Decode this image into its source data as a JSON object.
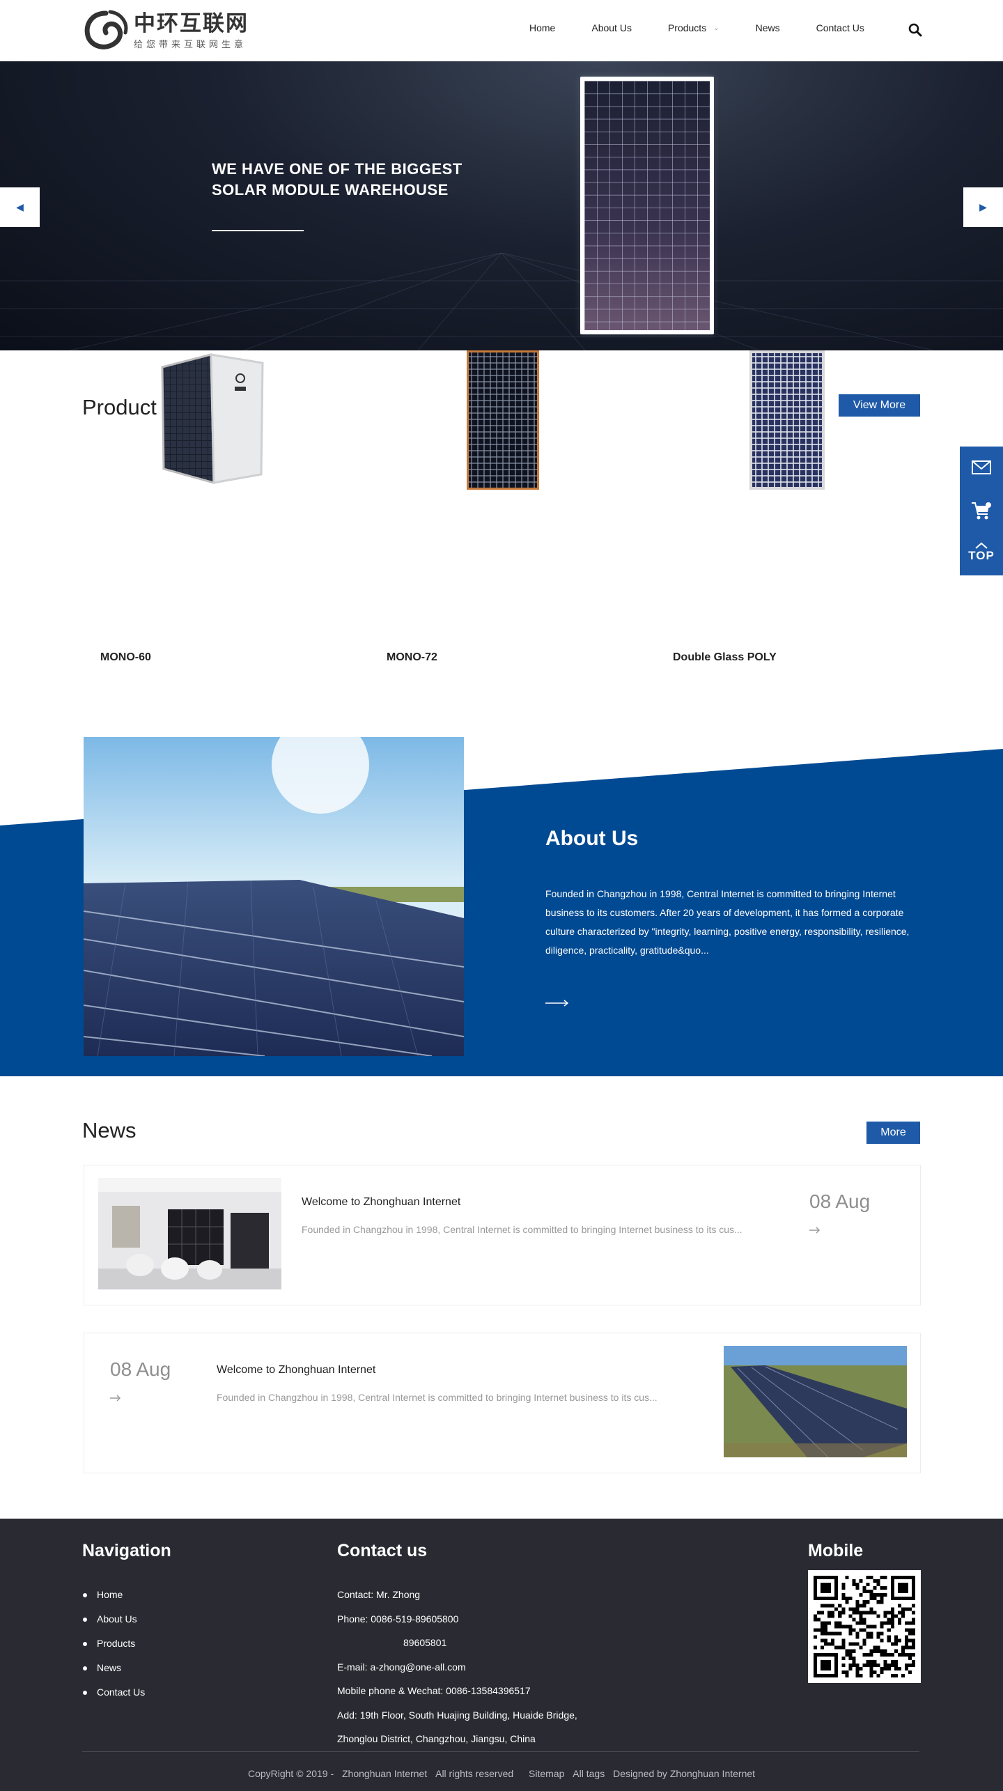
{
  "header": {
    "logo_cn": "中环互联网",
    "logo_sub": "给您带来互联网生意",
    "nav": [
      "Home",
      "About Us",
      "Products",
      "News",
      "Contact Us"
    ]
  },
  "banner": {
    "title_line1": "WE HAVE ONE OF THE BIGGEST",
    "title_line2": "SOLAR MODULE WAREHOUSE"
  },
  "products": {
    "title": "Product Center",
    "view_more": "View More",
    "items": [
      "MONO-60",
      "MONO-72",
      "Double Glass POLY"
    ]
  },
  "about": {
    "title": "About Us",
    "text": "Founded in Changzhou in 1998, Central Internet is committed to bringing Internet business to its customers. After 20 years of development, it has formed a corporate culture characterized by \"integrity, learning, positive energy, responsibility, resilience, diligence, practicality, gratitude&quo..."
  },
  "news": {
    "title": "News",
    "more": "More",
    "items": [
      {
        "title": "Welcome to Zhonghuan Internet",
        "desc": "Founded in Changzhou in 1998, Central Internet is committed to bringing Internet business to its cus...",
        "date": "08 Aug"
      },
      {
        "title": "Welcome to Zhonghuan Internet",
        "desc": "Founded in Changzhou in 1998, Central Internet is committed to bringing Internet business to its cus...",
        "date": "08 Aug"
      }
    ]
  },
  "sidebar": {
    "top": "TOP"
  },
  "footer": {
    "nav_title": "Navigation",
    "nav": [
      "Home",
      "About Us",
      "Products",
      "News",
      "Contact Us"
    ],
    "contact_title": "Contact us",
    "contact": {
      "person": "Contact: Mr. Zhong",
      "phone": "Phone: 0086-519-89605800",
      "phone2": "89605801",
      "email": "E-mail: a-zhong@one-all.com",
      "mobile": "Mobile phone & Wechat: 0086-13584396517",
      "address1": "Add: 19th Floor, South Huajing Building, Huaide Bridge,",
      "address2": "Zhonglou District, Changzhou, Jiangsu, China"
    },
    "mobile_title": "Mobile",
    "copyright": "CopyRight © 2019 -",
    "company": "Zhonghuan Internet",
    "rights": "All rights reserved",
    "sitemap": "Sitemap",
    "tags": "All tags",
    "designed": "Designed by Zhonghuan Internet"
  },
  "colors": {
    "accent": "#1e5aa8",
    "about_bg": "#004a93",
    "footer_bg": "#2a2a33"
  }
}
